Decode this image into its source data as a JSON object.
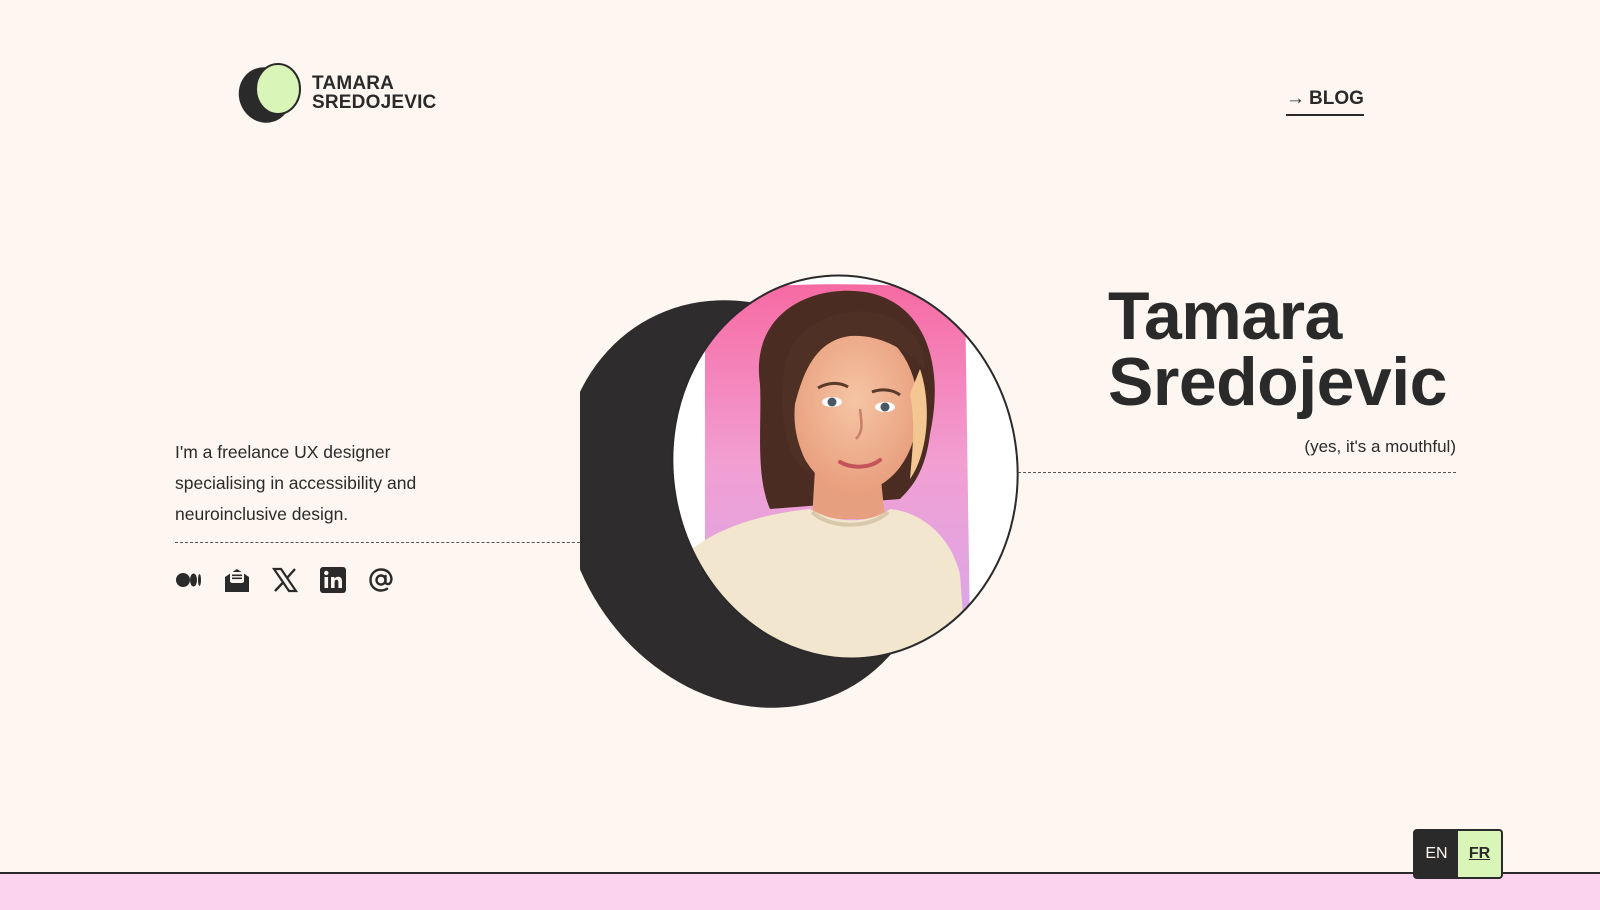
{
  "header": {
    "logo_line1": "TAMARA",
    "logo_line2": "SREDOJEVIC",
    "blog_arrow": "→",
    "blog_label": "BLOG"
  },
  "hero": {
    "intro": "I'm a freelance UX designer specialising in accessibility and neuroinclusive design.",
    "name_first": "Tamara",
    "name_last": "Sredojevic",
    "aside": "(yes, it's a mouthful)"
  },
  "socials": [
    {
      "name": "medium-icon"
    },
    {
      "name": "newsletter-icon"
    },
    {
      "name": "x-icon"
    },
    {
      "name": "linkedin-icon"
    },
    {
      "name": "email-icon"
    }
  ],
  "language": {
    "en_label": "EN",
    "fr_label": "FR",
    "selected": "FR"
  },
  "colors": {
    "background": "#fdf6f1",
    "ink": "#2b2a2a",
    "accent_green": "#d9f5b8",
    "accent_pink": "#fbd3ef"
  }
}
